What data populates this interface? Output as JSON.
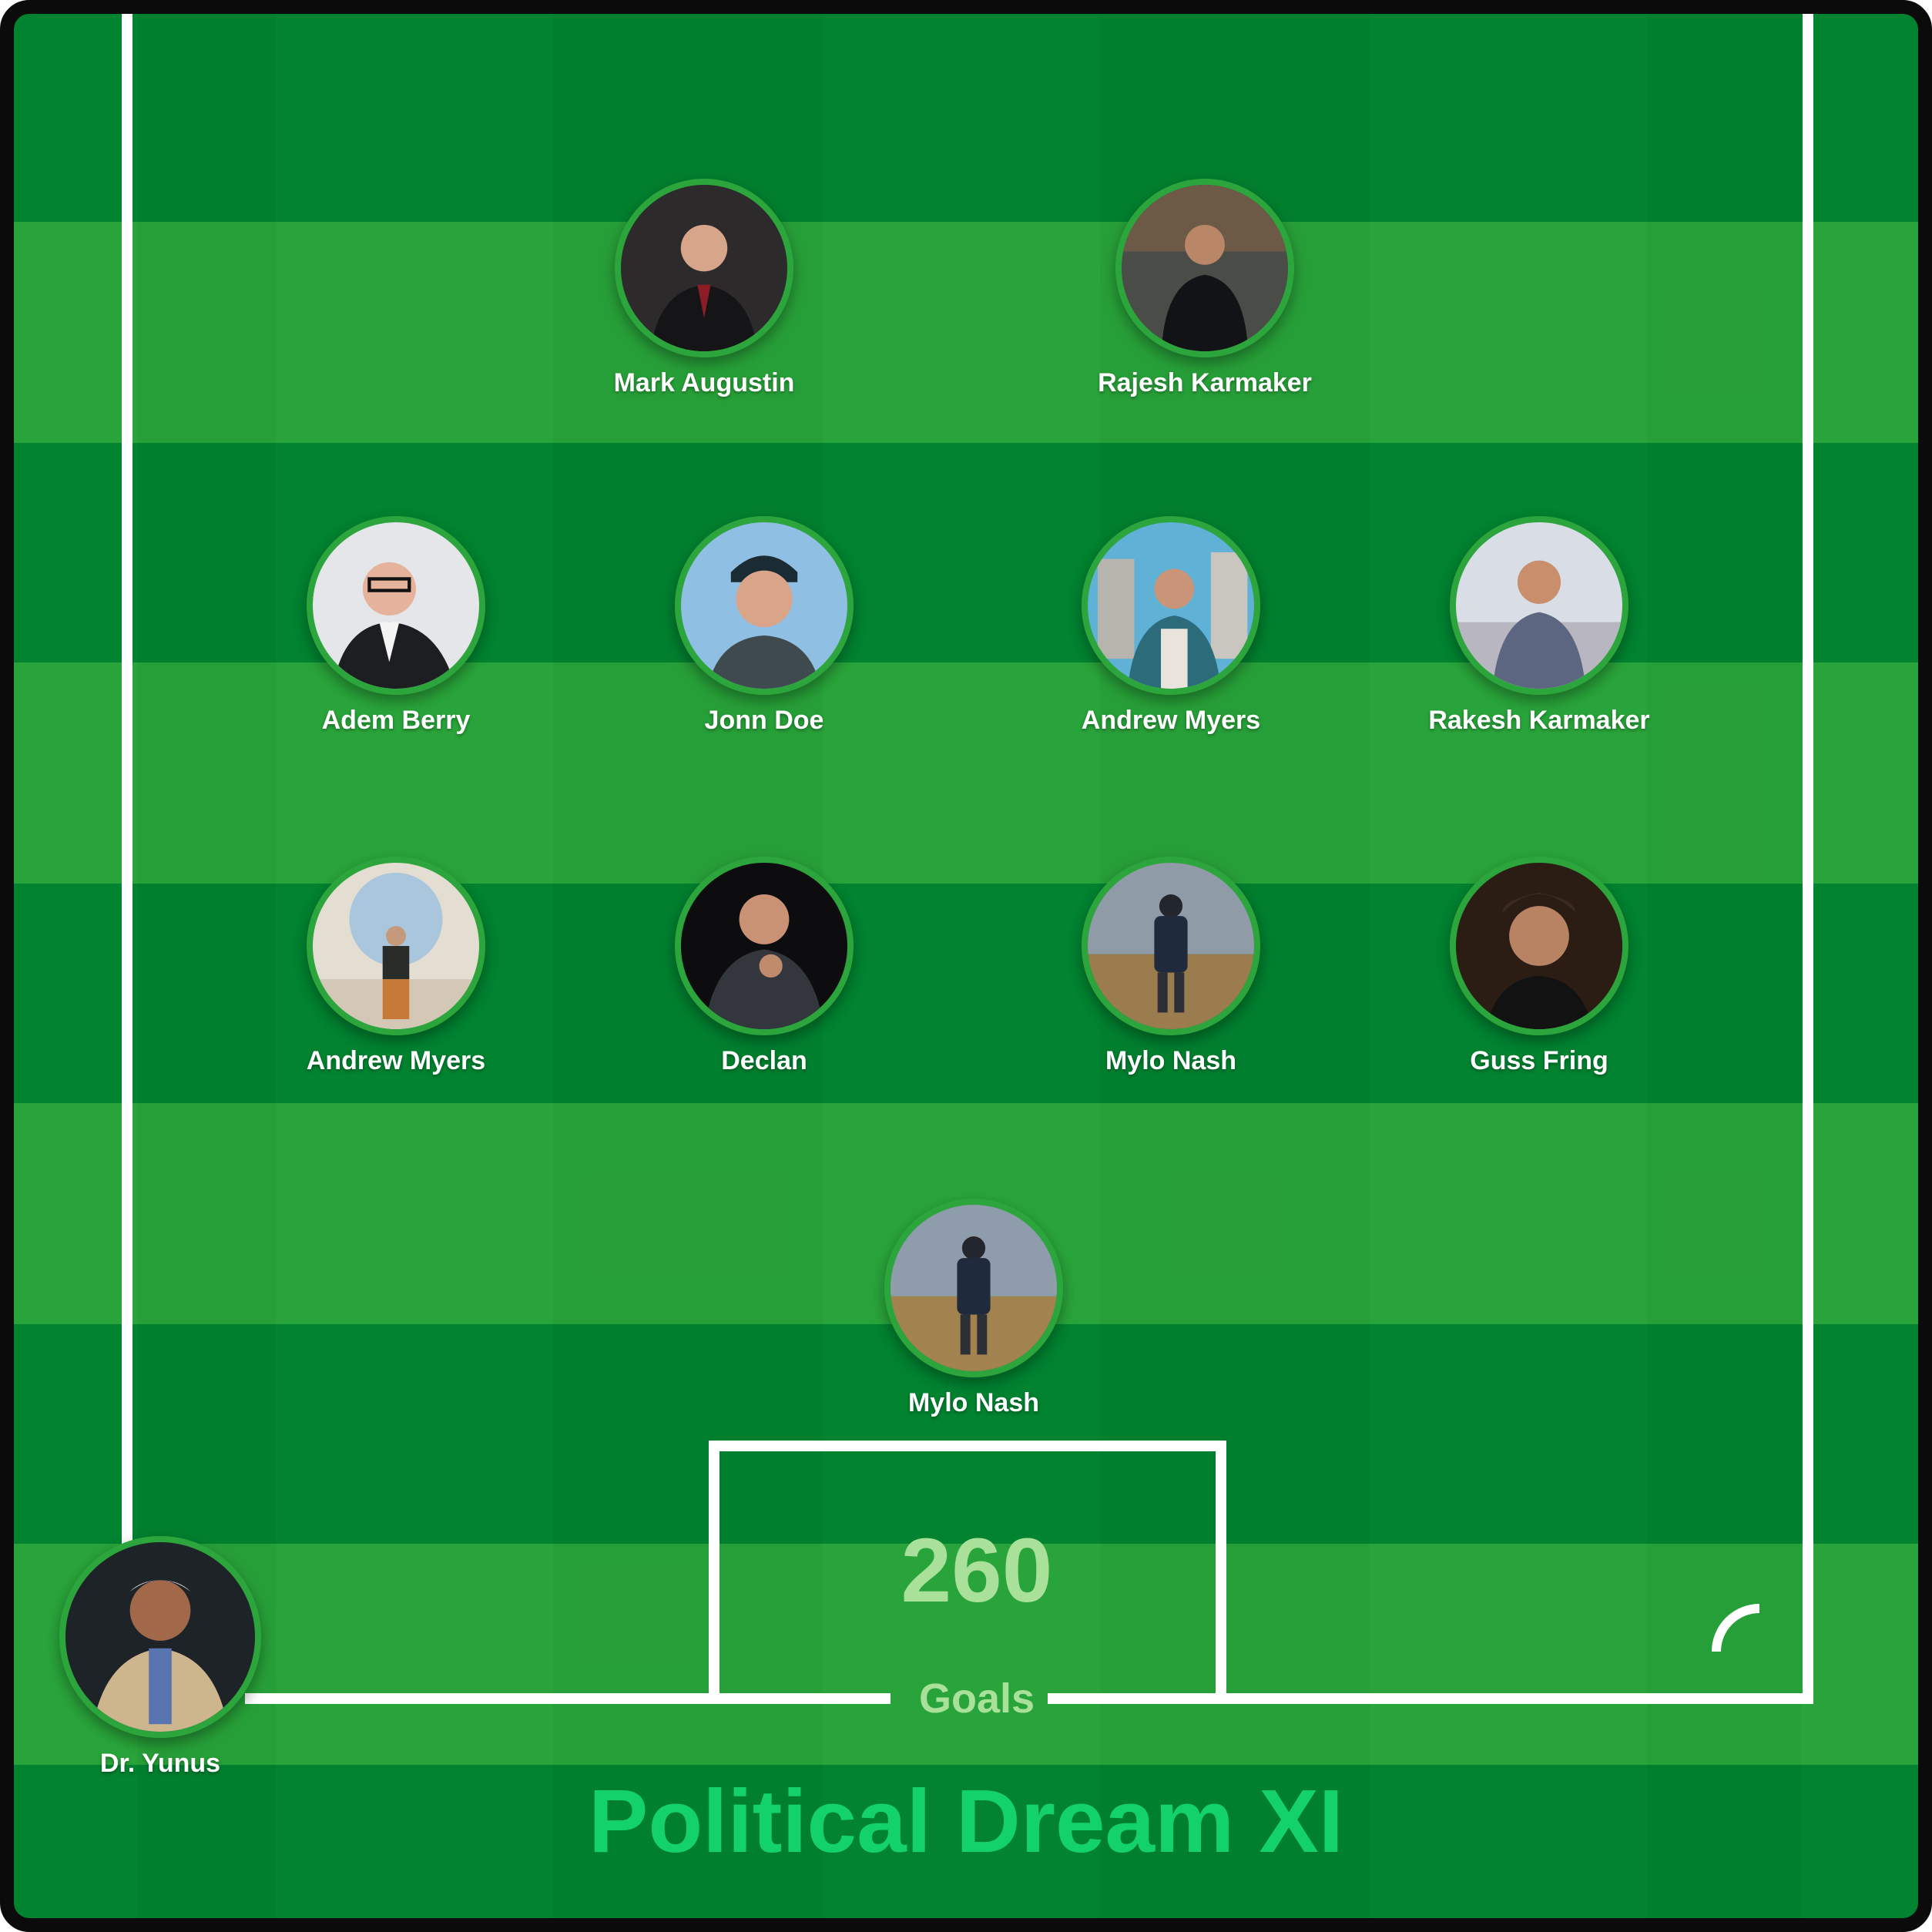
{
  "team": {
    "title": "Political Dream XI",
    "goals_value": "260",
    "goals_label": "Goals"
  },
  "colors": {
    "pitch_dark": "#018330",
    "pitch_light": "#29a43a",
    "lines": "#ffffff",
    "avatar_border": "#2ca53c",
    "score_text": "#a9e09a",
    "title_text": "#14d26a"
  },
  "players": [
    {
      "name": "Mark Augustin",
      "photo": "player-photo-icon"
    },
    {
      "name": "Rajesh Karmaker",
      "photo": "player-photo-icon"
    },
    {
      "name": "Adem Berry",
      "photo": "player-photo-icon"
    },
    {
      "name": "Jonn Doe",
      "photo": "player-photo-icon"
    },
    {
      "name": "Andrew Myers",
      "photo": "player-photo-icon"
    },
    {
      "name": "Rakesh Karmaker",
      "photo": "player-photo-icon"
    },
    {
      "name": "Andrew Myers",
      "photo": "player-photo-icon"
    },
    {
      "name": "Declan",
      "photo": "player-photo-icon"
    },
    {
      "name": "Mylo Nash",
      "photo": "player-photo-icon"
    },
    {
      "name": "Guss Fring",
      "photo": "player-photo-icon"
    },
    {
      "name": "Mylo Nash",
      "photo": "player-photo-icon"
    }
  ],
  "coach": {
    "name": "Dr. Yunus",
    "photo": "coach-photo-icon"
  }
}
